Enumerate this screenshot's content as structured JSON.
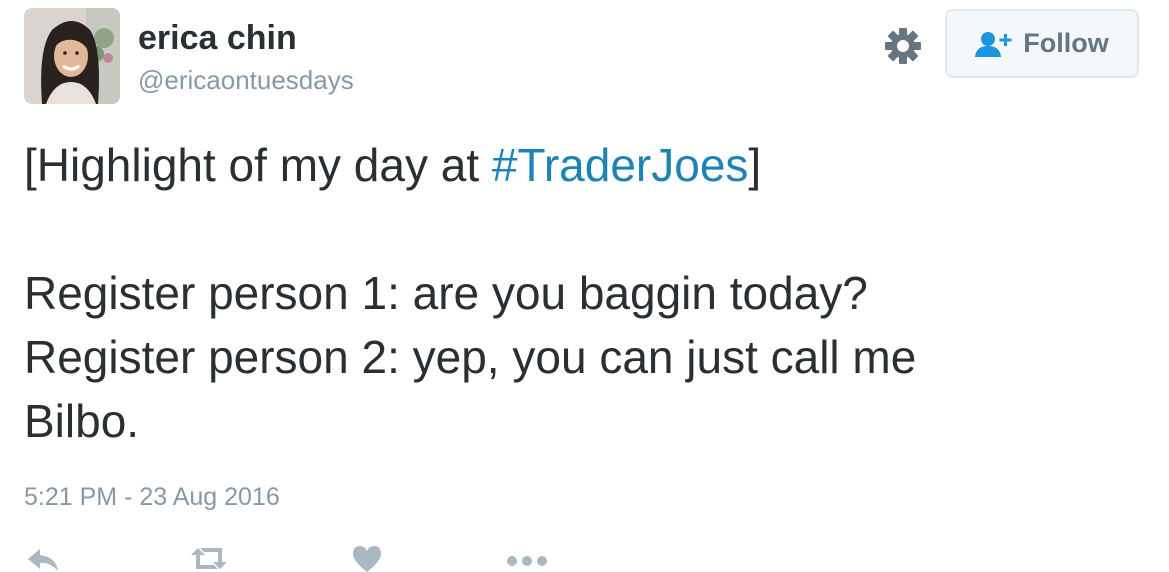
{
  "user": {
    "display_name": "erica chin",
    "handle": "@ericaontuesdays",
    "avatar": "profile-photo"
  },
  "header": {
    "follow_label": "Follow",
    "follow_icon": "add-user-icon",
    "settings_icon": "gear-icon"
  },
  "tweet": {
    "line1_prefix": "[Highlight of my day at ",
    "hashtag": "#TraderJoes",
    "line1_suffix": "]",
    "line2": "Register person 1: are you baggin today?",
    "line3": "Register person 2: yep, you can just call me",
    "line4": "Bilbo.",
    "timestamp": "5:21 PM - 23 Aug 2016"
  },
  "actions": [
    {
      "icon": "reply-icon"
    },
    {
      "icon": "retweet-icon"
    },
    {
      "icon": "like-heart-icon"
    },
    {
      "icon": "more-dots-icon"
    }
  ],
  "colors": {
    "link": "#1d83b7",
    "text": "#292f33",
    "muted": "#8899a6",
    "icon": "#aab8c2"
  }
}
